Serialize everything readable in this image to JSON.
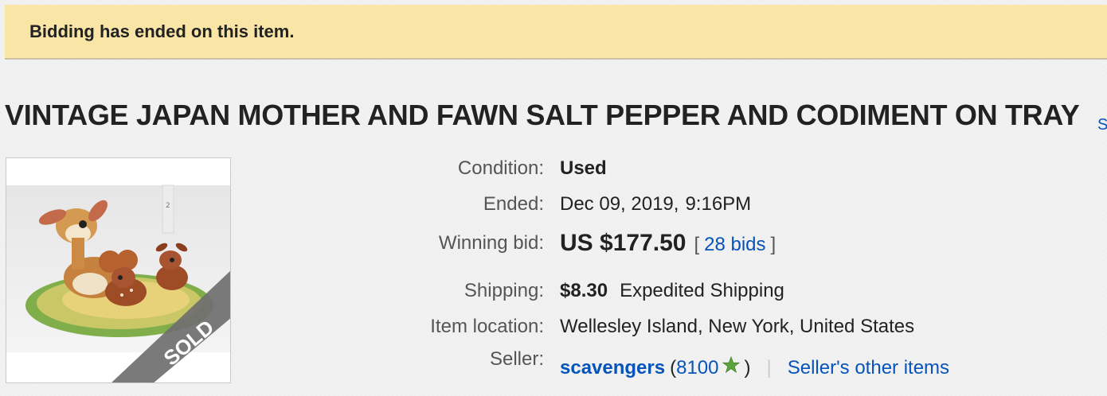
{
  "banner": {
    "text": "Bidding has ended on this item."
  },
  "title": "VINTAGE JAPAN MOTHER AND FAWN SALT PEPPER AND CODIMENT ON TRAY",
  "title_link": "S",
  "image": {
    "overlay_text": "SOLD",
    "ruler_marks": [
      "2"
    ]
  },
  "details": {
    "condition": {
      "label": "Condition:",
      "value": "Used"
    },
    "ended": {
      "label": "Ended:",
      "date": "Dec 09, 2019",
      "sep": ",",
      "time": "9:16PM"
    },
    "winning_bid": {
      "label": "Winning bid:",
      "price": "US $177.50",
      "open": "[",
      "bids": "28 bids",
      "close": "]"
    },
    "shipping": {
      "label": "Shipping:",
      "cost": "$8.30",
      "method": "Expedited Shipping"
    },
    "location": {
      "label": "Item location:",
      "value": "Wellesley Island, New York, United States"
    },
    "seller": {
      "label": "Seller:",
      "name": "scavengers",
      "open": "(",
      "score": "8100",
      "close": ")",
      "divider": "|",
      "other_items": "Seller's other items"
    }
  },
  "colors": {
    "banner_bg": "#f9e5a6",
    "link": "#0654ba",
    "star": "#5ca33b"
  },
  "icons": {
    "feedback_star": "green-star-icon"
  }
}
